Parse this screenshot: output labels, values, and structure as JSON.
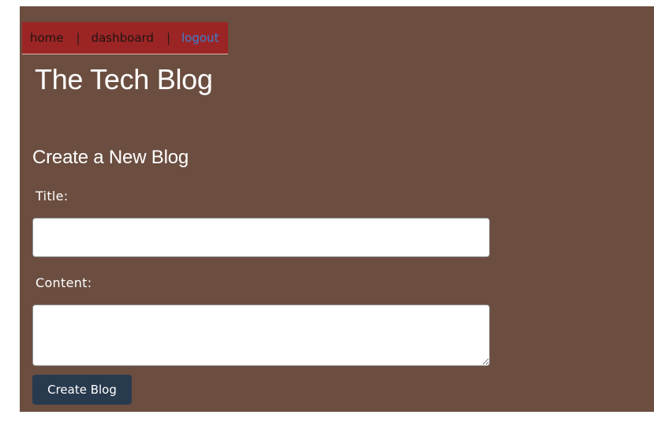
{
  "nav": {
    "home_label": "home",
    "separator": "|",
    "dashboard_label": "dashboard",
    "logout_label": "logout"
  },
  "header": {
    "site_title": "The Tech Blog"
  },
  "form": {
    "heading": "Create a New Blog",
    "title_label": "Title:",
    "title_value": "",
    "content_label": "Content:",
    "content_value": "",
    "submit_label": "Create Blog"
  },
  "colors": {
    "page_bg": "#6b4e40",
    "nav_bg": "#9b2525",
    "logout_link": "#3d7fd0",
    "button_bg": "#283a4e"
  }
}
